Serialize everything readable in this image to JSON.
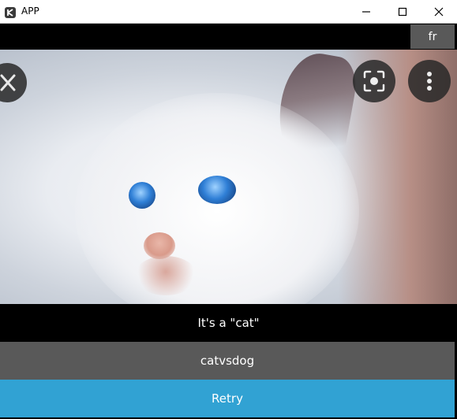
{
  "window": {
    "title": "APP"
  },
  "toolbar": {
    "language_label": "fr"
  },
  "result": {
    "text": "It's a \"cat\""
  },
  "actions": {
    "model_label": "catvsdog",
    "retry_label": "Retry"
  },
  "icons": [
    "app-icon",
    "minimize-icon",
    "maximize-icon",
    "close-icon",
    "lens-icon",
    "more-vertical-icon"
  ],
  "colors": {
    "accent": "#31a2d3",
    "button_gray": "#595959",
    "background": "#000000"
  }
}
